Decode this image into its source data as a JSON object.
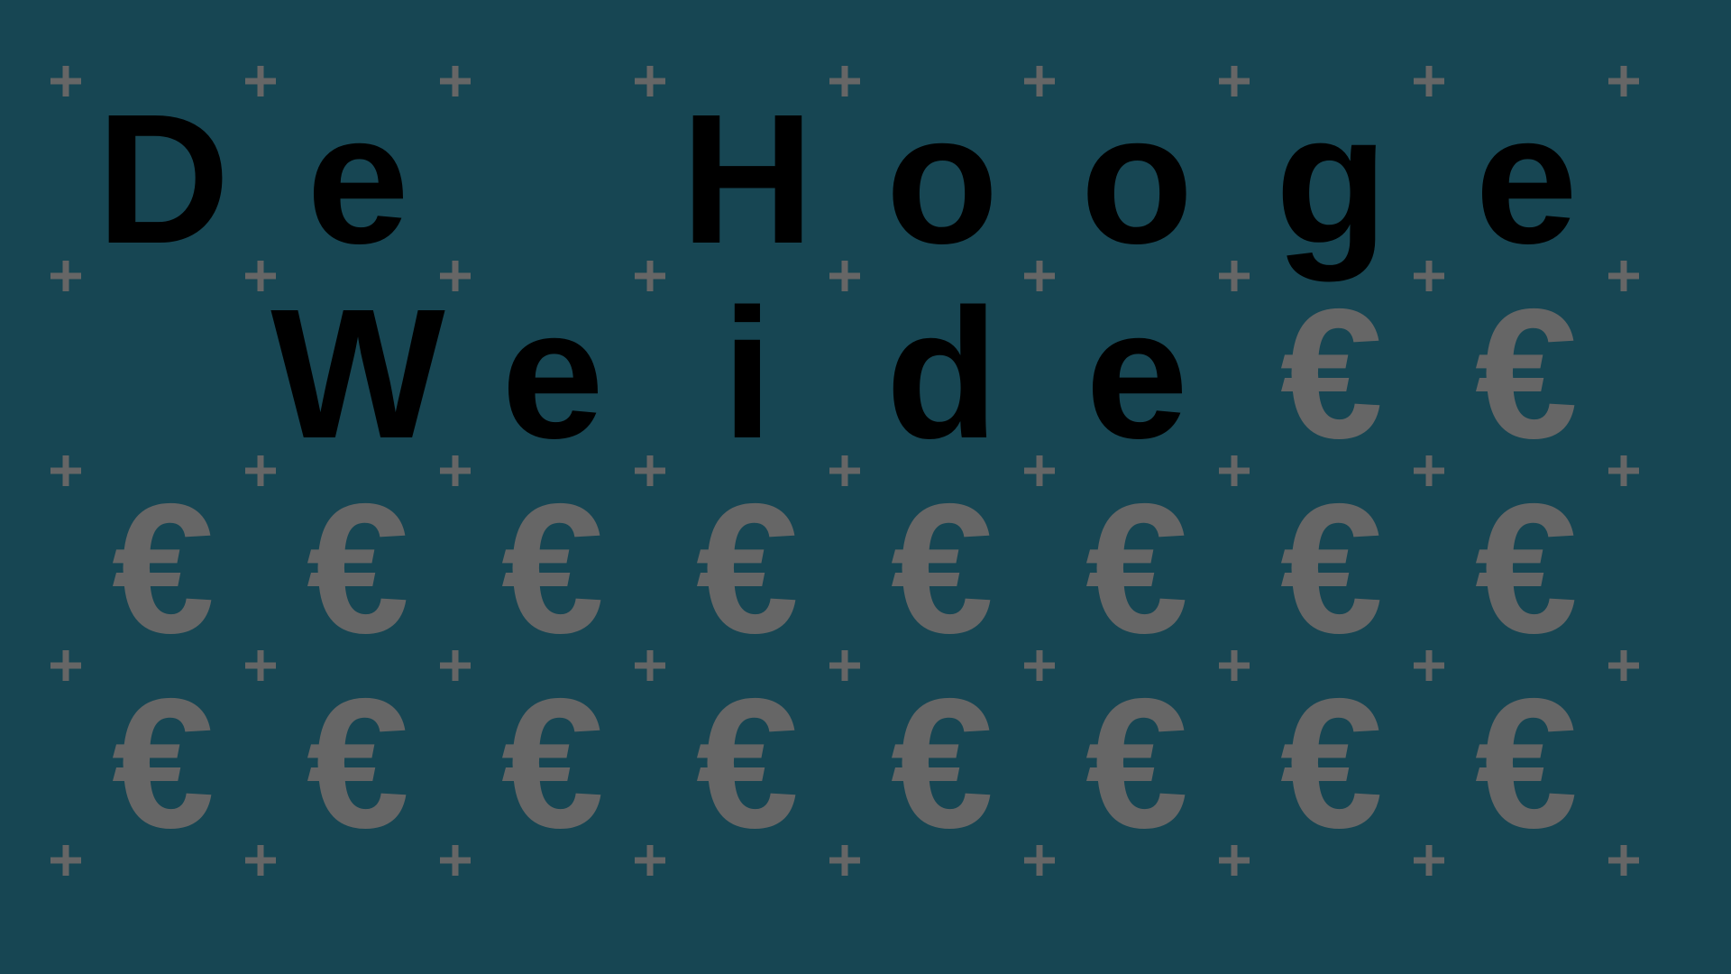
{
  "colors": {
    "background": "#174653",
    "text": "#000000",
    "symbol": "#666666",
    "grid_marker": "#666666"
  },
  "grid_marker_icon": "plus-icon",
  "title_rows": [
    [
      "D",
      "e",
      "",
      "H",
      "o",
      "o",
      "g",
      "e"
    ],
    [
      "",
      "W",
      "e",
      "i",
      "d",
      "e",
      "",
      ""
    ]
  ],
  "symbol_rows": [
    [
      "",
      "",
      "",
      "",
      "",
      "",
      "",
      ""
    ],
    [
      "",
      "",
      "",
      "",
      "",
      "",
      "€",
      "€"
    ],
    [
      "€",
      "€",
      "€",
      "€",
      "€",
      "€",
      "€",
      "€"
    ],
    [
      "€",
      "€",
      "€",
      "€",
      "€",
      "€",
      "€",
      "€"
    ]
  ]
}
